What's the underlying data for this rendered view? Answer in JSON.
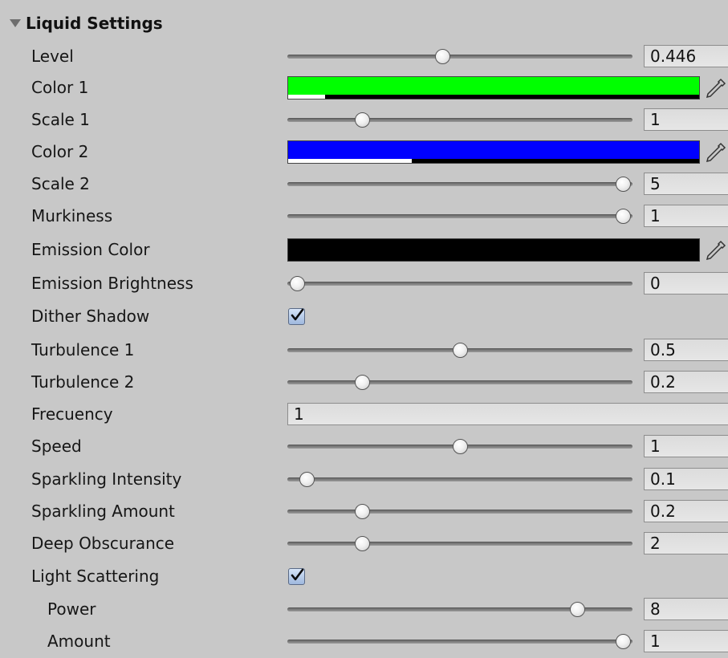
{
  "section": {
    "title": "Liquid Settings",
    "expanded": true
  },
  "rows": {
    "level": {
      "label": "Level",
      "value": "0.446",
      "position": 0.446
    },
    "color1": {
      "label": "Color 1",
      "color": "#00ff00",
      "alpha": 0.09
    },
    "scale1": {
      "label": "Scale 1",
      "value": "1",
      "position": 0.2
    },
    "color2": {
      "label": "Color 2",
      "color": "#0000ff",
      "alpha": 0.3
    },
    "scale2": {
      "label": "Scale 2",
      "value": "5",
      "position": 1.0
    },
    "murkiness": {
      "label": "Murkiness",
      "value": "1",
      "position": 1.0
    },
    "emissionColor": {
      "label": "Emission Color",
      "color": "#000000",
      "alpha": 0.0
    },
    "emissionBrightness": {
      "label": "Emission Brightness",
      "value": "0",
      "position": 0.0
    },
    "ditherShadow": {
      "label": "Dither Shadow",
      "checked": true
    },
    "turbulence1": {
      "label": "Turbulence 1",
      "value": "0.5",
      "position": 0.5
    },
    "turbulence2": {
      "label": "Turbulence 2",
      "value": "0.2",
      "position": 0.2
    },
    "frecuency": {
      "label": "Frecuency",
      "value": "1"
    },
    "speed": {
      "label": "Speed",
      "value": "1",
      "position": 0.5
    },
    "sparklingIntensity": {
      "label": "Sparkling Intensity",
      "value": "0.1",
      "position": 0.03
    },
    "sparklingAmount": {
      "label": "Sparkling Amount",
      "value": "0.2",
      "position": 0.2
    },
    "deepObscurance": {
      "label": "Deep Obscurance",
      "value": "2",
      "position": 0.2
    },
    "lightScattering": {
      "label": "Light Scattering",
      "checked": true
    },
    "power": {
      "label": "Power",
      "value": "8",
      "position": 0.86
    },
    "amount": {
      "label": "Amount",
      "value": "1",
      "position": 1.0
    }
  },
  "icons": {
    "foldout": "triangle-down-icon",
    "eyedropper": "eyedropper-icon",
    "check": "checkmark-icon"
  }
}
